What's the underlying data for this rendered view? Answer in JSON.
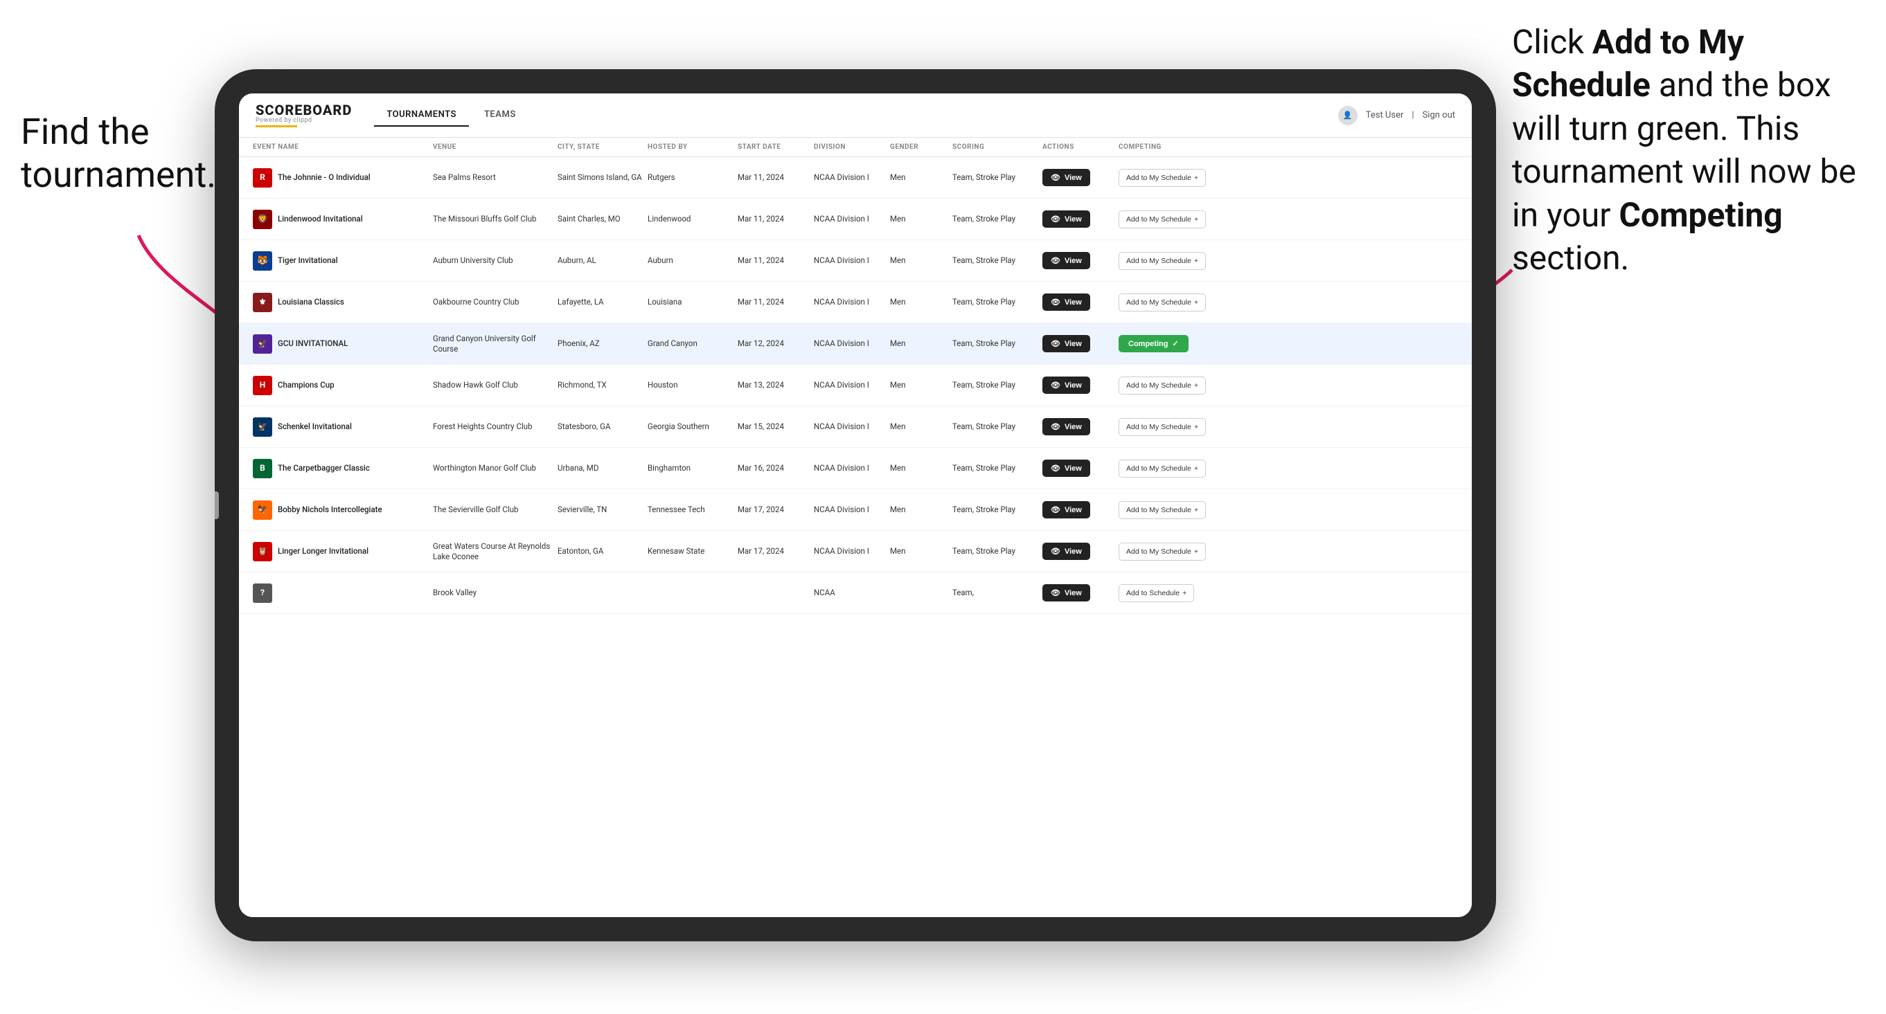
{
  "annotations": {
    "left": "Find the tournament.",
    "right_line1": "Click ",
    "right_bold1": "Add to My Schedule",
    "right_line2": " and the box will turn green. This tournament will now be in your ",
    "right_bold2": "Competing",
    "right_line3": " section."
  },
  "header": {
    "logo": "SCOREBOARD",
    "logo_sub": "Powered by clippd",
    "tabs": [
      "TOURNAMENTS",
      "TEAMS"
    ],
    "active_tab": "TOURNAMENTS",
    "user": "Test User",
    "sign_out": "Sign out"
  },
  "table": {
    "columns": [
      "EVENT NAME",
      "VENUE",
      "CITY, STATE",
      "HOSTED BY",
      "START DATE",
      "DIVISION",
      "GENDER",
      "SCORING",
      "ACTIONS",
      "COMPETING"
    ],
    "rows": [
      {
        "logo_color": "#cc0000",
        "logo_text": "R",
        "event": "The Johnnie - O Individual",
        "venue": "Sea Palms Resort",
        "city": "Saint Simons Island, GA",
        "hosted": "Rutgers",
        "date": "Mar 11, 2024",
        "division": "NCAA Division I",
        "gender": "Men",
        "scoring": "Team, Stroke Play",
        "action": "View",
        "competing": "Add to My Schedule",
        "is_competing": false,
        "highlighted": false
      },
      {
        "logo_color": "#333333",
        "logo_text": "🦁",
        "event": "Lindenwood Invitational",
        "venue": "The Missouri Bluffs Golf Club",
        "city": "Saint Charles, MO",
        "hosted": "Lindenwood",
        "date": "Mar 11, 2024",
        "division": "NCAA Division I",
        "gender": "Men",
        "scoring": "Team, Stroke Play",
        "action": "View",
        "competing": "Add to My Schedule",
        "is_competing": false,
        "highlighted": false
      },
      {
        "logo_color": "#0b3d91",
        "logo_text": "🐯",
        "event": "Tiger Invitational",
        "venue": "Auburn University Club",
        "city": "Auburn, AL",
        "hosted": "Auburn",
        "date": "Mar 11, 2024",
        "division": "NCAA Division I",
        "gender": "Men",
        "scoring": "Team, Stroke Play",
        "action": "View",
        "competing": "Add to My Schedule",
        "is_competing": false,
        "highlighted": false
      },
      {
        "logo_color": "#cc0000",
        "logo_text": "⚜",
        "event": "Louisiana Classics",
        "venue": "Oakbourne Country Club",
        "city": "Lafayette, LA",
        "hosted": "Louisiana",
        "date": "Mar 11, 2024",
        "division": "NCAA Division I",
        "gender": "Men",
        "scoring": "Team, Stroke Play",
        "action": "View",
        "competing": "Add to My Schedule",
        "is_competing": false,
        "highlighted": false
      },
      {
        "logo_color": "#522398",
        "logo_text": "🦅",
        "event": "GCU INVITATIONAL",
        "venue": "Grand Canyon University Golf Course",
        "city": "Phoenix, AZ",
        "hosted": "Grand Canyon",
        "date": "Mar 12, 2024",
        "division": "NCAA Division I",
        "gender": "Men",
        "scoring": "Team, Stroke Play",
        "action": "View",
        "competing": "Competing",
        "is_competing": true,
        "highlighted": true
      },
      {
        "logo_color": "#cc0000",
        "logo_text": "H",
        "event": "Champions Cup",
        "venue": "Shadow Hawk Golf Club",
        "city": "Richmond, TX",
        "hosted": "Houston",
        "date": "Mar 13, 2024",
        "division": "NCAA Division I",
        "gender": "Men",
        "scoring": "Team, Stroke Play",
        "action": "View",
        "competing": "Add to My Schedule",
        "is_competing": false,
        "highlighted": false
      },
      {
        "logo_color": "#003366",
        "logo_text": "🦅",
        "event": "Schenkel Invitational",
        "venue": "Forest Heights Country Club",
        "city": "Statesboro, GA",
        "hosted": "Georgia Southern",
        "date": "Mar 15, 2024",
        "division": "NCAA Division I",
        "gender": "Men",
        "scoring": "Team, Stroke Play",
        "action": "View",
        "competing": "Add to My Schedule",
        "is_competing": false,
        "highlighted": false
      },
      {
        "logo_color": "#006633",
        "logo_text": "B",
        "event": "The Carpetbagger Classic",
        "venue": "Worthington Manor Golf Club",
        "city": "Urbana, MD",
        "hosted": "Binghamton",
        "date": "Mar 16, 2024",
        "division": "NCAA Division I",
        "gender": "Men",
        "scoring": "Team, Stroke Play",
        "action": "View",
        "competing": "Add to My Schedule",
        "is_competing": false,
        "highlighted": false
      },
      {
        "logo_color": "#ff6600",
        "logo_text": "🦅",
        "event": "Bobby Nichols Intercollegiate",
        "venue": "The Sevierville Golf Club",
        "city": "Sevierville, TN",
        "hosted": "Tennessee Tech",
        "date": "Mar 17, 2024",
        "division": "NCAA Division I",
        "gender": "Men",
        "scoring": "Team, Stroke Play",
        "action": "View",
        "competing": "Add to My Schedule",
        "is_competing": false,
        "highlighted": false
      },
      {
        "logo_color": "#cc0000",
        "logo_text": "🦉",
        "event": "Linger Longer Invitational",
        "venue": "Great Waters Course At Reynolds Lake Oconee",
        "city": "Eatonton, GA",
        "hosted": "Kennesaw State",
        "date": "Mar 17, 2024",
        "division": "NCAA Division I",
        "gender": "Men",
        "scoring": "Team, Stroke Play",
        "action": "View",
        "competing": "Add to My Schedule",
        "is_competing": false,
        "highlighted": false
      },
      {
        "logo_color": "#555",
        "logo_text": "?",
        "event": "",
        "venue": "Brook Valley",
        "city": "",
        "hosted": "",
        "date": "",
        "division": "NCAA",
        "gender": "",
        "scoring": "Team,",
        "action": "View",
        "competing": "Add to Schedule",
        "is_competing": false,
        "highlighted": false
      }
    ]
  },
  "logo_emojis": {
    "rutgers": "🅡",
    "lindenwood": "🦁",
    "auburn": "🐯",
    "louisiana": "⚜",
    "gcu": "🦅",
    "houston": "🐾",
    "georgia_southern": "🦅",
    "binghamton": "🅑",
    "tennessee_tech": "🦅",
    "kennesaw": "🦉"
  }
}
